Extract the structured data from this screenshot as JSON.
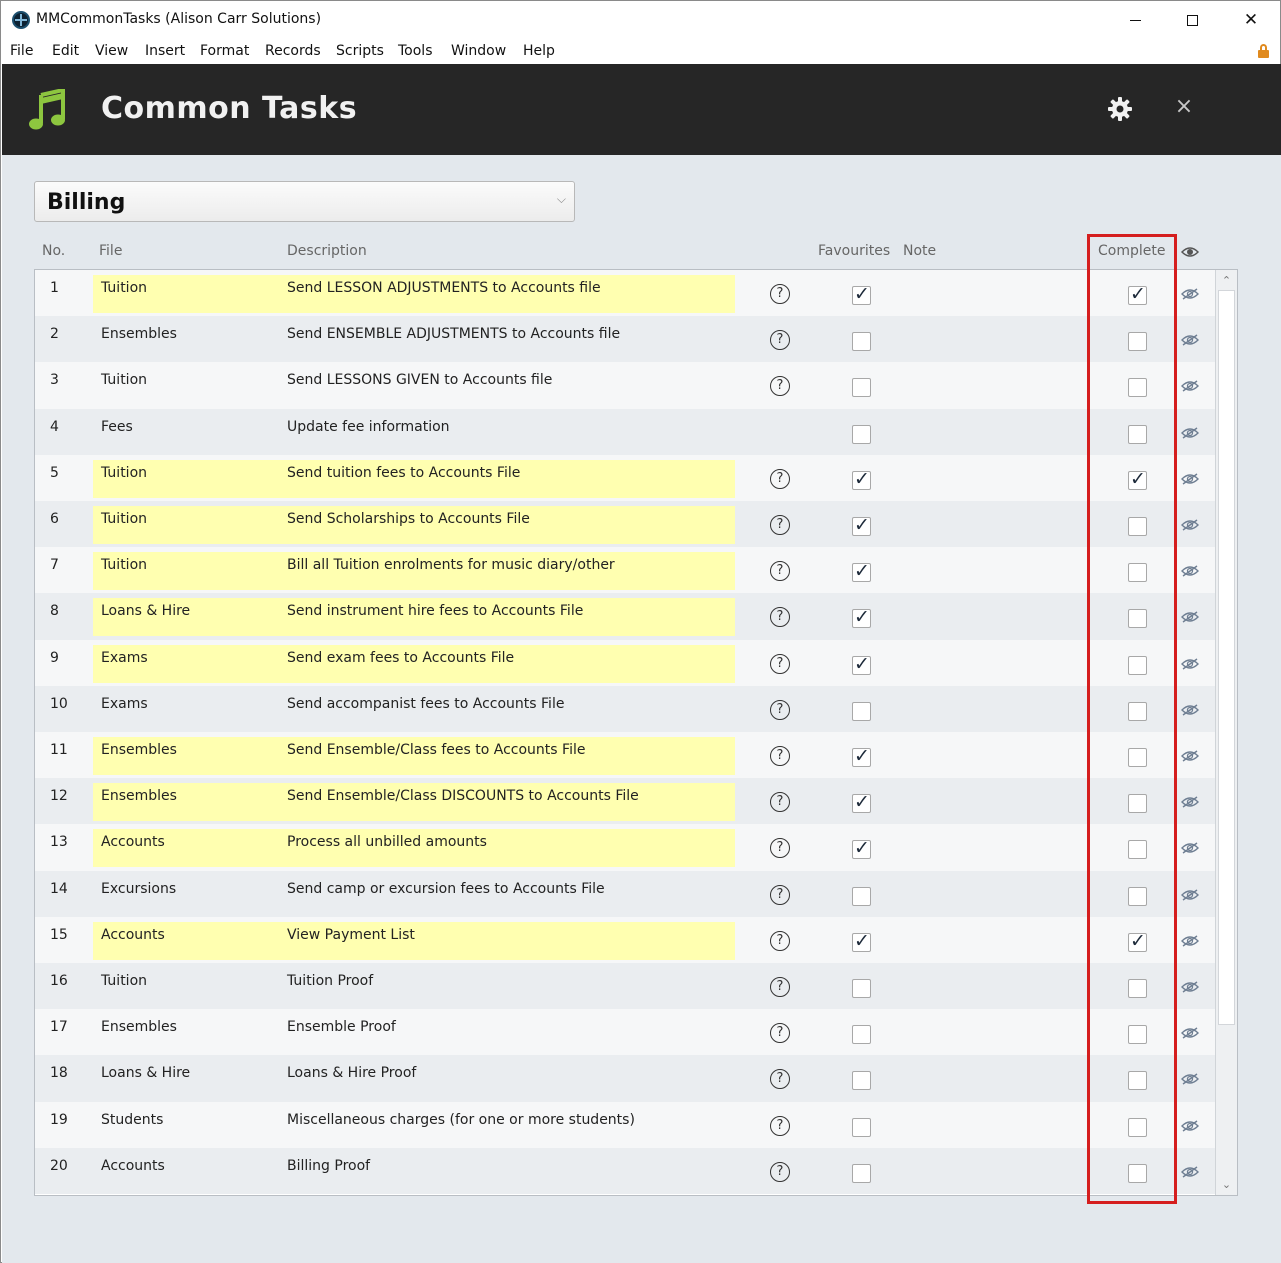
{
  "window": {
    "title": "MMCommonTasks (Alison Carr Solutions)",
    "close_glyph": "✕"
  },
  "menu": [
    "File",
    "Edit",
    "View",
    "Insert",
    "Format",
    "Records",
    "Scripts",
    "Tools",
    "Window",
    "Help"
  ],
  "header": {
    "title": "Common Tasks",
    "close_glyph": "×",
    "accent_color": "#8dc63f"
  },
  "category": {
    "selected": "Billing",
    "chevron": "⌵"
  },
  "columns": {
    "no": "No.",
    "file": "File",
    "description": "Description",
    "favourites": "Favourites",
    "note": "Note",
    "complete": "Complete"
  },
  "help_glyph": "?",
  "check_glyph": "✓",
  "scroll": {
    "up": "⌃",
    "down": "⌄"
  },
  "rows": [
    {
      "no": "1",
      "file": "Tuition",
      "description": "Send LESSON ADJUSTMENTS to Accounts file",
      "highlight": true,
      "help": true,
      "favourite": true,
      "complete": true
    },
    {
      "no": "2",
      "file": "Ensembles",
      "description": "Send ENSEMBLE ADJUSTMENTS to Accounts file",
      "highlight": false,
      "help": true,
      "favourite": false,
      "complete": false
    },
    {
      "no": "3",
      "file": "Tuition",
      "description": "Send LESSONS GIVEN to Accounts file",
      "highlight": false,
      "help": true,
      "favourite": false,
      "complete": false
    },
    {
      "no": "4",
      "file": "Fees",
      "description": "Update fee information",
      "highlight": false,
      "help": false,
      "favourite": false,
      "complete": false
    },
    {
      "no": "5",
      "file": "Tuition",
      "description": "Send tuition fees to Accounts File",
      "highlight": true,
      "help": true,
      "favourite": true,
      "complete": true
    },
    {
      "no": "6",
      "file": "Tuition",
      "description": "Send Scholarships to Accounts File",
      "highlight": true,
      "help": true,
      "favourite": true,
      "complete": false
    },
    {
      "no": "7",
      "file": "Tuition",
      "description": "Bill all Tuition enrolments for music diary/other",
      "highlight": true,
      "help": true,
      "favourite": true,
      "complete": false
    },
    {
      "no": "8",
      "file": "Loans & Hire",
      "description": "Send instrument hire fees to Accounts File",
      "highlight": true,
      "help": true,
      "favourite": true,
      "complete": false
    },
    {
      "no": "9",
      "file": "Exams",
      "description": "Send exam fees to Accounts File",
      "highlight": true,
      "help": true,
      "favourite": true,
      "complete": false
    },
    {
      "no": "10",
      "file": "Exams",
      "description": "Send accompanist fees to Accounts File",
      "highlight": false,
      "help": true,
      "favourite": false,
      "complete": false
    },
    {
      "no": "11",
      "file": "Ensembles",
      "description": "Send Ensemble/Class fees to Accounts File",
      "highlight": true,
      "help": true,
      "favourite": true,
      "complete": false
    },
    {
      "no": "12",
      "file": "Ensembles",
      "description": "Send Ensemble/Class DISCOUNTS to Accounts File",
      "highlight": true,
      "help": true,
      "favourite": true,
      "complete": false
    },
    {
      "no": "13",
      "file": "Accounts",
      "description": "Process all unbilled amounts",
      "highlight": true,
      "help": true,
      "favourite": true,
      "complete": false
    },
    {
      "no": "14",
      "file": "Excursions",
      "description": "Send camp or excursion fees to Accounts File",
      "highlight": false,
      "help": true,
      "favourite": false,
      "complete": false
    },
    {
      "no": "15",
      "file": "Accounts",
      "description": "View Payment List",
      "highlight": true,
      "help": true,
      "favourite": true,
      "complete": true
    },
    {
      "no": "16",
      "file": "Tuition",
      "description": "Tuition Proof",
      "highlight": false,
      "help": true,
      "favourite": false,
      "complete": false
    },
    {
      "no": "17",
      "file": "Ensembles",
      "description": "Ensemble Proof",
      "highlight": false,
      "help": true,
      "favourite": false,
      "complete": false
    },
    {
      "no": "18",
      "file": "Loans & Hire",
      "description": "Loans & Hire Proof",
      "highlight": false,
      "help": true,
      "favourite": false,
      "complete": false
    },
    {
      "no": "19",
      "file": "Students",
      "description": "Miscellaneous charges (for one or more students)",
      "highlight": false,
      "help": true,
      "favourite": false,
      "complete": false
    },
    {
      "no": "20",
      "file": "Accounts",
      "description": "Billing Proof",
      "highlight": false,
      "help": true,
      "favourite": false,
      "complete": false
    }
  ],
  "colors": {
    "header_bg": "#262626",
    "content_bg": "#e3e8ed",
    "highlight": "#ffffb0",
    "annotation": "#d51e1e"
  }
}
